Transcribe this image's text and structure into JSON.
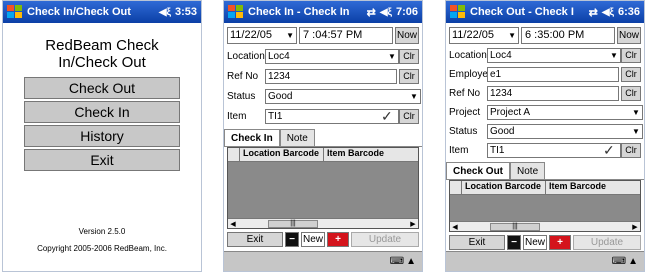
{
  "screen1": {
    "title": "Check In/Check Out",
    "time": "3:53",
    "app_title_line1": "RedBeam Check",
    "app_title_line2": "In/Check Out",
    "menu": [
      "Check Out",
      "Check In",
      "History",
      "Exit"
    ],
    "version": "Version 2.5.0",
    "copyright": "Copyright 2005-2006 RedBeam, Inc."
  },
  "screen2": {
    "title": "Check In - Check In",
    "time": "7:06",
    "date": "11/22/05",
    "time_field": "7 :04:57 PM",
    "now_label": "Now",
    "fields": [
      {
        "label": "Location",
        "value": "Loc4"
      },
      {
        "label": "Ref No",
        "value": "1234"
      },
      {
        "label": "Status",
        "value": "Good"
      },
      {
        "label": "Item",
        "value": "TI1"
      }
    ],
    "clr_label": "Clr",
    "tabs": [
      "Check In",
      "Note"
    ],
    "columns": [
      "Location Barcode",
      "Item Barcode"
    ],
    "buttons": {
      "exit": "Exit",
      "new": "New",
      "update": "Update"
    }
  },
  "screen3": {
    "title": "Check Out - Check I",
    "time": "6:36",
    "date": "11/22/05",
    "time_field": "6 :35:00 PM",
    "now_label": "Now",
    "fields": [
      {
        "label": "Location",
        "value": "Loc4"
      },
      {
        "label": "Employee",
        "value": "e1"
      },
      {
        "label": "Ref No",
        "value": "1234"
      },
      {
        "label": "Project",
        "value": "Project A"
      },
      {
        "label": "Status",
        "value": "Good"
      },
      {
        "label": "Item",
        "value": "TI1"
      }
    ],
    "clr_label": "Clr",
    "tabs": [
      "Check Out",
      "Note"
    ],
    "columns": [
      "Location Barcode",
      "Item Barcode"
    ],
    "buttons": {
      "exit": "Exit",
      "new": "New",
      "update": "Update"
    }
  },
  "icons": {
    "start": "windows-flag-icon",
    "volume": "speaker-icon",
    "sync": "sync-icon",
    "keyboard": "keyboard-icon"
  },
  "colors": {
    "titlebar": "#0b3fa6",
    "plus_button": "#d4141c"
  }
}
